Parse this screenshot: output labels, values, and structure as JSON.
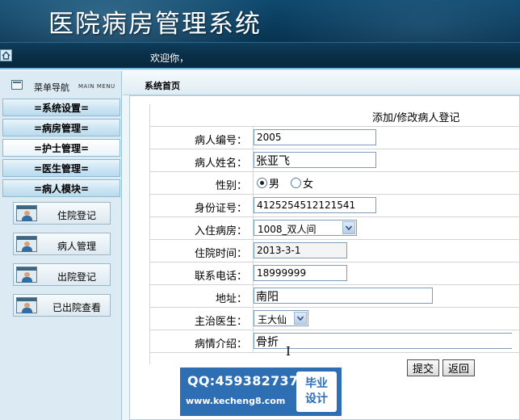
{
  "header": {
    "title": "医院病房管理系统",
    "welcome": "欢迎你，"
  },
  "sidebar": {
    "title": "菜单导航",
    "subtitle": "MAIN MENU",
    "categories": [
      {
        "label": "=系统设置="
      },
      {
        "label": "=病房管理="
      },
      {
        "label": "=护士管理="
      },
      {
        "label": "=医生管理="
      },
      {
        "label": "=病人模块="
      }
    ],
    "items": [
      {
        "label": "住院登记"
      },
      {
        "label": "病人管理"
      },
      {
        "label": "出院登记"
      },
      {
        "label": "已出院查看"
      }
    ]
  },
  "main": {
    "breadcrumb": "系统首页",
    "form": {
      "caption": "添加/修改病人登记",
      "fields": {
        "id": {
          "label": "病人编号：",
          "value": "2005"
        },
        "name": {
          "label": "病人姓名：",
          "value": "张亚飞"
        },
        "gender": {
          "label": "性别：",
          "options": [
            "男",
            "女"
          ],
          "selected": "男"
        },
        "idcard": {
          "label": "身份证号：",
          "value": "4125254512121541"
        },
        "ward": {
          "label": "入住病房：",
          "value": "1008_双人间"
        },
        "admit_date": {
          "label": "住院时间：",
          "value": "2013-3-1"
        },
        "phone": {
          "label": "联系电话：",
          "value": "18999999"
        },
        "address": {
          "label": "地址：",
          "value": "南阳"
        },
        "doctor": {
          "label": "主治医生：",
          "value": "王大仙"
        },
        "description": {
          "label": "病情介绍：",
          "value": "骨折"
        }
      },
      "submit_label": "提交",
      "back_label": "返回"
    }
  },
  "watermark": {
    "qq": "QQ:459382737",
    "url": "www.kecheng8.com",
    "badge_line1": "毕业",
    "badge_line2": "设计"
  }
}
